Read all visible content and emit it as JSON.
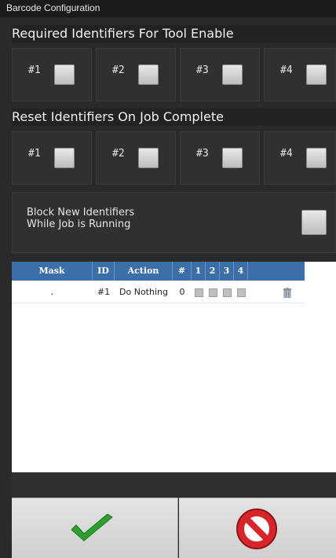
{
  "window": {
    "title": "Barcode Configuration"
  },
  "required_section": {
    "title": "Required Identifiers For Tool Enable",
    "items": [
      {
        "label": "#1",
        "checked": false
      },
      {
        "label": "#2",
        "checked": false
      },
      {
        "label": "#3",
        "checked": false
      },
      {
        "label": "#4",
        "checked": false
      }
    ]
  },
  "reset_section": {
    "title": "Reset Identifiers On Job Complete",
    "items": [
      {
        "label": "#1",
        "checked": false
      },
      {
        "label": "#2",
        "checked": false
      },
      {
        "label": "#3",
        "checked": false
      },
      {
        "label": "#4",
        "checked": false
      }
    ]
  },
  "block_option": {
    "line1": "Block New Identifiers",
    "line2": "While Job is Running",
    "checked": false
  },
  "table": {
    "headers": [
      "Mask",
      "ID",
      "Action",
      "#",
      "1",
      "2",
      "3",
      "4",
      ""
    ],
    "rows": [
      {
        "mask": ".",
        "id": "#1",
        "action": "Do Nothing",
        "count": "0"
      }
    ]
  },
  "buttons": {
    "ok_icon": "green-check-icon",
    "cancel_icon": "red-cancel-icon"
  },
  "colors": {
    "header_blue": "#3c6ea8",
    "ok_green": "#2e9e2e",
    "cancel_red": "#d6262b"
  }
}
